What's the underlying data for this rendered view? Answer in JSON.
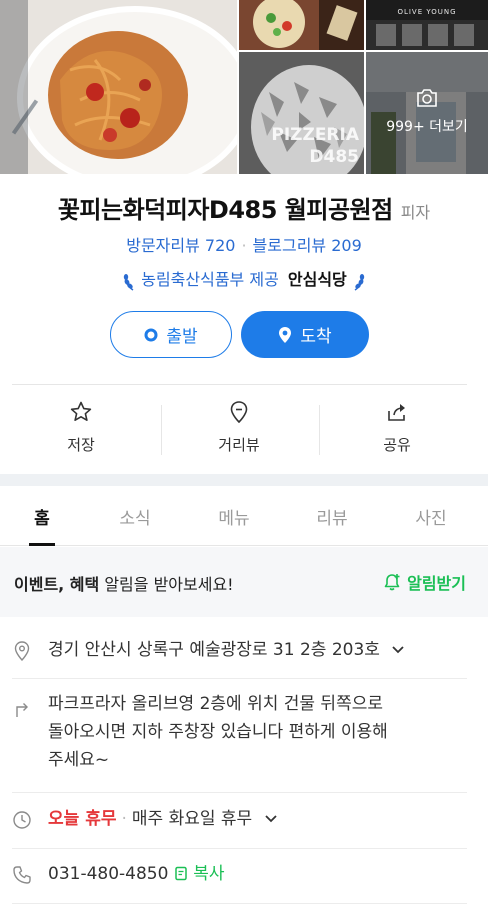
{
  "photos": {
    "more_count": "999+",
    "more_label": "더보기",
    "photo4_text_line1": "PIZZERIA",
    "photo4_text_line2": "D485",
    "photo3_sign": "OLIVE YOUNG"
  },
  "place": {
    "name": "꽃피는화덕피자D485 월피공원점",
    "category": "피자",
    "visitor_reviews": "방문자리뷰 720",
    "blog_reviews": "블로그리뷰 209",
    "badge_text": "농림축산식품부 제공",
    "badge_name": "안심식당"
  },
  "nav_buttons": {
    "depart": "출발",
    "arrive": "도착"
  },
  "actions": {
    "save": "저장",
    "street_view": "거리뷰",
    "share": "공유"
  },
  "tabs": [
    {
      "label": "홈"
    },
    {
      "label": "소식"
    },
    {
      "label": "메뉴"
    },
    {
      "label": "리뷰"
    },
    {
      "label": "사진"
    }
  ],
  "event": {
    "bold": "이벤트, 혜택",
    "rest": " 알림을 받아보세요!",
    "alarm_label": "알림받기"
  },
  "info": {
    "address": "경기 안산시 상록구 예술광장로 31 2층 203호",
    "directions_line1": "파크프라자 올리브영 2층에 위치 건물 뒤쪽으로",
    "directions_line2": "돌아오시면 지하 주창장 있습니다 편하게 이용해",
    "directions_line3": "주세요~",
    "hours_status": "오늘 휴무",
    "hours_detail": "매주 화요일 휴무",
    "phone": "031-480-4850",
    "copy_label": "복사"
  },
  "colors": {
    "accent_blue": "#1e7ce8",
    "link_blue": "#2a6bd1",
    "green": "#1bbf55",
    "closed_red": "#e5383b"
  }
}
